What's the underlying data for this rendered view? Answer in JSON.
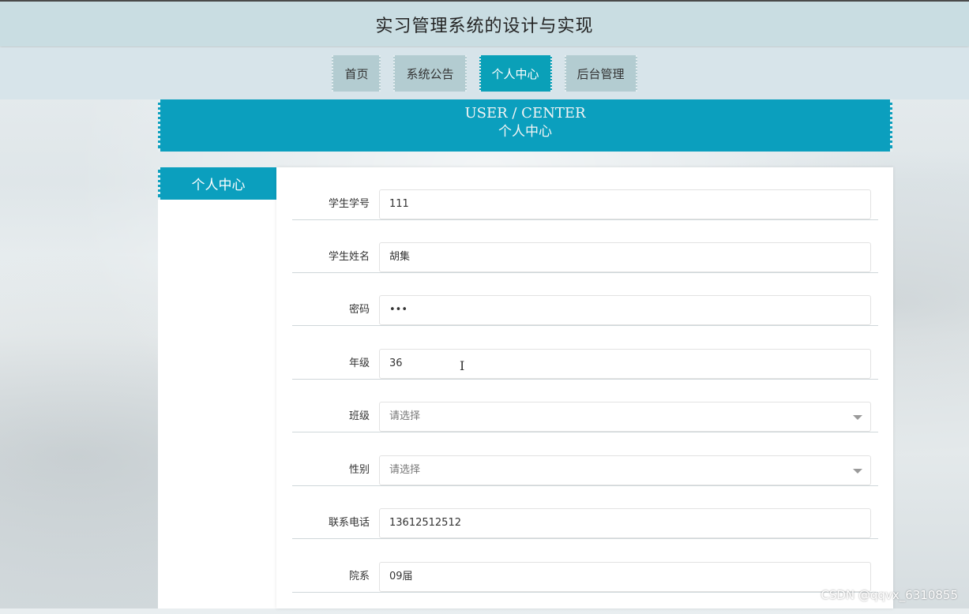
{
  "header": {
    "title": "实习管理系统的设计与实现"
  },
  "nav": {
    "items": [
      {
        "label": "首页",
        "active": false
      },
      {
        "label": "系统公告",
        "active": false
      },
      {
        "label": "个人中心",
        "active": true
      },
      {
        "label": "后台管理",
        "active": false
      }
    ]
  },
  "banner": {
    "en": "USER / CENTER",
    "cn": "个人中心"
  },
  "sidebar": {
    "tab_label": "个人中心"
  },
  "form": {
    "fields": [
      {
        "label": "学生学号",
        "value": "111",
        "type": "text"
      },
      {
        "label": "学生姓名",
        "value": "胡集",
        "type": "text"
      },
      {
        "label": "密码",
        "value": "•••",
        "type": "password"
      },
      {
        "label": "年级",
        "value": "36",
        "type": "text"
      },
      {
        "label": "班级",
        "value": "请选择",
        "type": "select"
      },
      {
        "label": "性别",
        "value": "请选择",
        "type": "select"
      },
      {
        "label": "联系电话",
        "value": "13612512512",
        "type": "text"
      },
      {
        "label": "院系",
        "value": "09届",
        "type": "text"
      }
    ]
  },
  "watermark": "CSDN @qqvx_6310855",
  "colors": {
    "accent": "#0b9fbe",
    "nav_inactive": "#b3ccd1",
    "title_bar": "#c9dde2"
  },
  "icons": {
    "select_caret": "chevron-down-icon",
    "cursor": "text-cursor-icon"
  }
}
